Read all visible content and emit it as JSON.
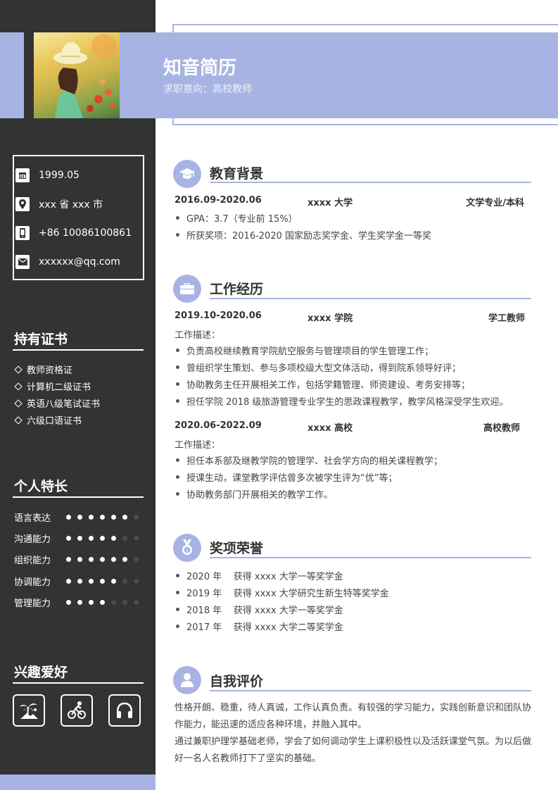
{
  "header": {
    "name": "知音简历",
    "intent_label": "求职意向：",
    "intent_value": "高校教师"
  },
  "contact": [
    {
      "icon": "calendar-icon",
      "text": "1999.05"
    },
    {
      "icon": "location-pin-icon",
      "text": "xxx 省 xxx 市"
    },
    {
      "icon": "phone-icon",
      "text": "+86 10086100861"
    },
    {
      "icon": "mail-icon",
      "text": "xxxxxx@qq.com"
    }
  ],
  "certificates": {
    "title": "持有证书",
    "items": [
      "教师资格证",
      "计算机二级证书",
      "英语八级笔试证书",
      "六级口语证书"
    ]
  },
  "skills": {
    "title": "个人特长",
    "items": [
      {
        "label": "语言表达",
        "level": 6,
        "max": 7
      },
      {
        "label": "沟通能力",
        "level": 5,
        "max": 7
      },
      {
        "label": "组织能力",
        "level": 6,
        "max": 7
      },
      {
        "label": "协调能力",
        "level": 5,
        "max": 7
      },
      {
        "label": "管理能力",
        "level": 4,
        "max": 7
      }
    ]
  },
  "hobbies": {
    "title": "兴趣爱好",
    "items": [
      "palm-tree-icon",
      "cycling-icon",
      "headphones-icon"
    ]
  },
  "education": {
    "title": "教育背景",
    "date": "2016.09-2020.06",
    "org": "xxxx 大学",
    "role": "文学专业/本科",
    "bullets": [
      "GPA：3.7（专业前 15%）",
      "所获奖项：2016-2020 国家励志奖学金、学生奖学金一等奖"
    ]
  },
  "work": {
    "title": "工作经历",
    "entries": [
      {
        "date": "2019.10-2020.06",
        "org": "xxxx 学院",
        "role": "学工教师",
        "desc_label": "工作描述：",
        "bullets": [
          "负责高校继续教育学院航空服务与管理项目的学生管理工作；",
          "曾组织学生策划、参与多项校级大型文体活动，得到院系领导好评；",
          "协助教务主任开展相关工作，包括学籍管理、师资建设、考务安排等；",
          "担任学院 2018 级旅游管理专业学生的思政课程教学，教学风格深受学生欢迎。"
        ]
      },
      {
        "date": "2020.06-2022.09",
        "org": "xxxx 高校",
        "role": "高校教师",
        "desc_label": "工作描述：",
        "bullets": [
          "担任本系部及继教学院的管理学、社会学方向的相关课程教学；",
          "授课生动，课堂教学评估曾多次被学生评为“优”等；",
          "协助教务部门开展相关的教学工作。"
        ]
      }
    ]
  },
  "awards": {
    "title": "奖项荣誉",
    "items": [
      "2020 年    获得 xxxx 大学一等奖学金",
      "2019 年    获得 xxxx 大学研究生新生特等奖学金",
      "2018 年    获得 xxxx 大学一等奖学金",
      "2017 年    获得 xxxx 大学二等奖学金"
    ]
  },
  "self_eval": {
    "title": "自我评价",
    "p1": "性格开朗、稳重，待人真诚，工作认真负责。有较强的学习能力，实践创新意识和团队协作能力，能迅速的适应各种环境，并融入其中。",
    "p2": "通过兼职护理学基础老师，学会了如何调动学生上课积极性以及活跃课堂气氛。为以后做好一名人名教师打下了坚实的基础。"
  },
  "colors": {
    "accent": "#a7b4e3",
    "sidebar": "#333333"
  }
}
